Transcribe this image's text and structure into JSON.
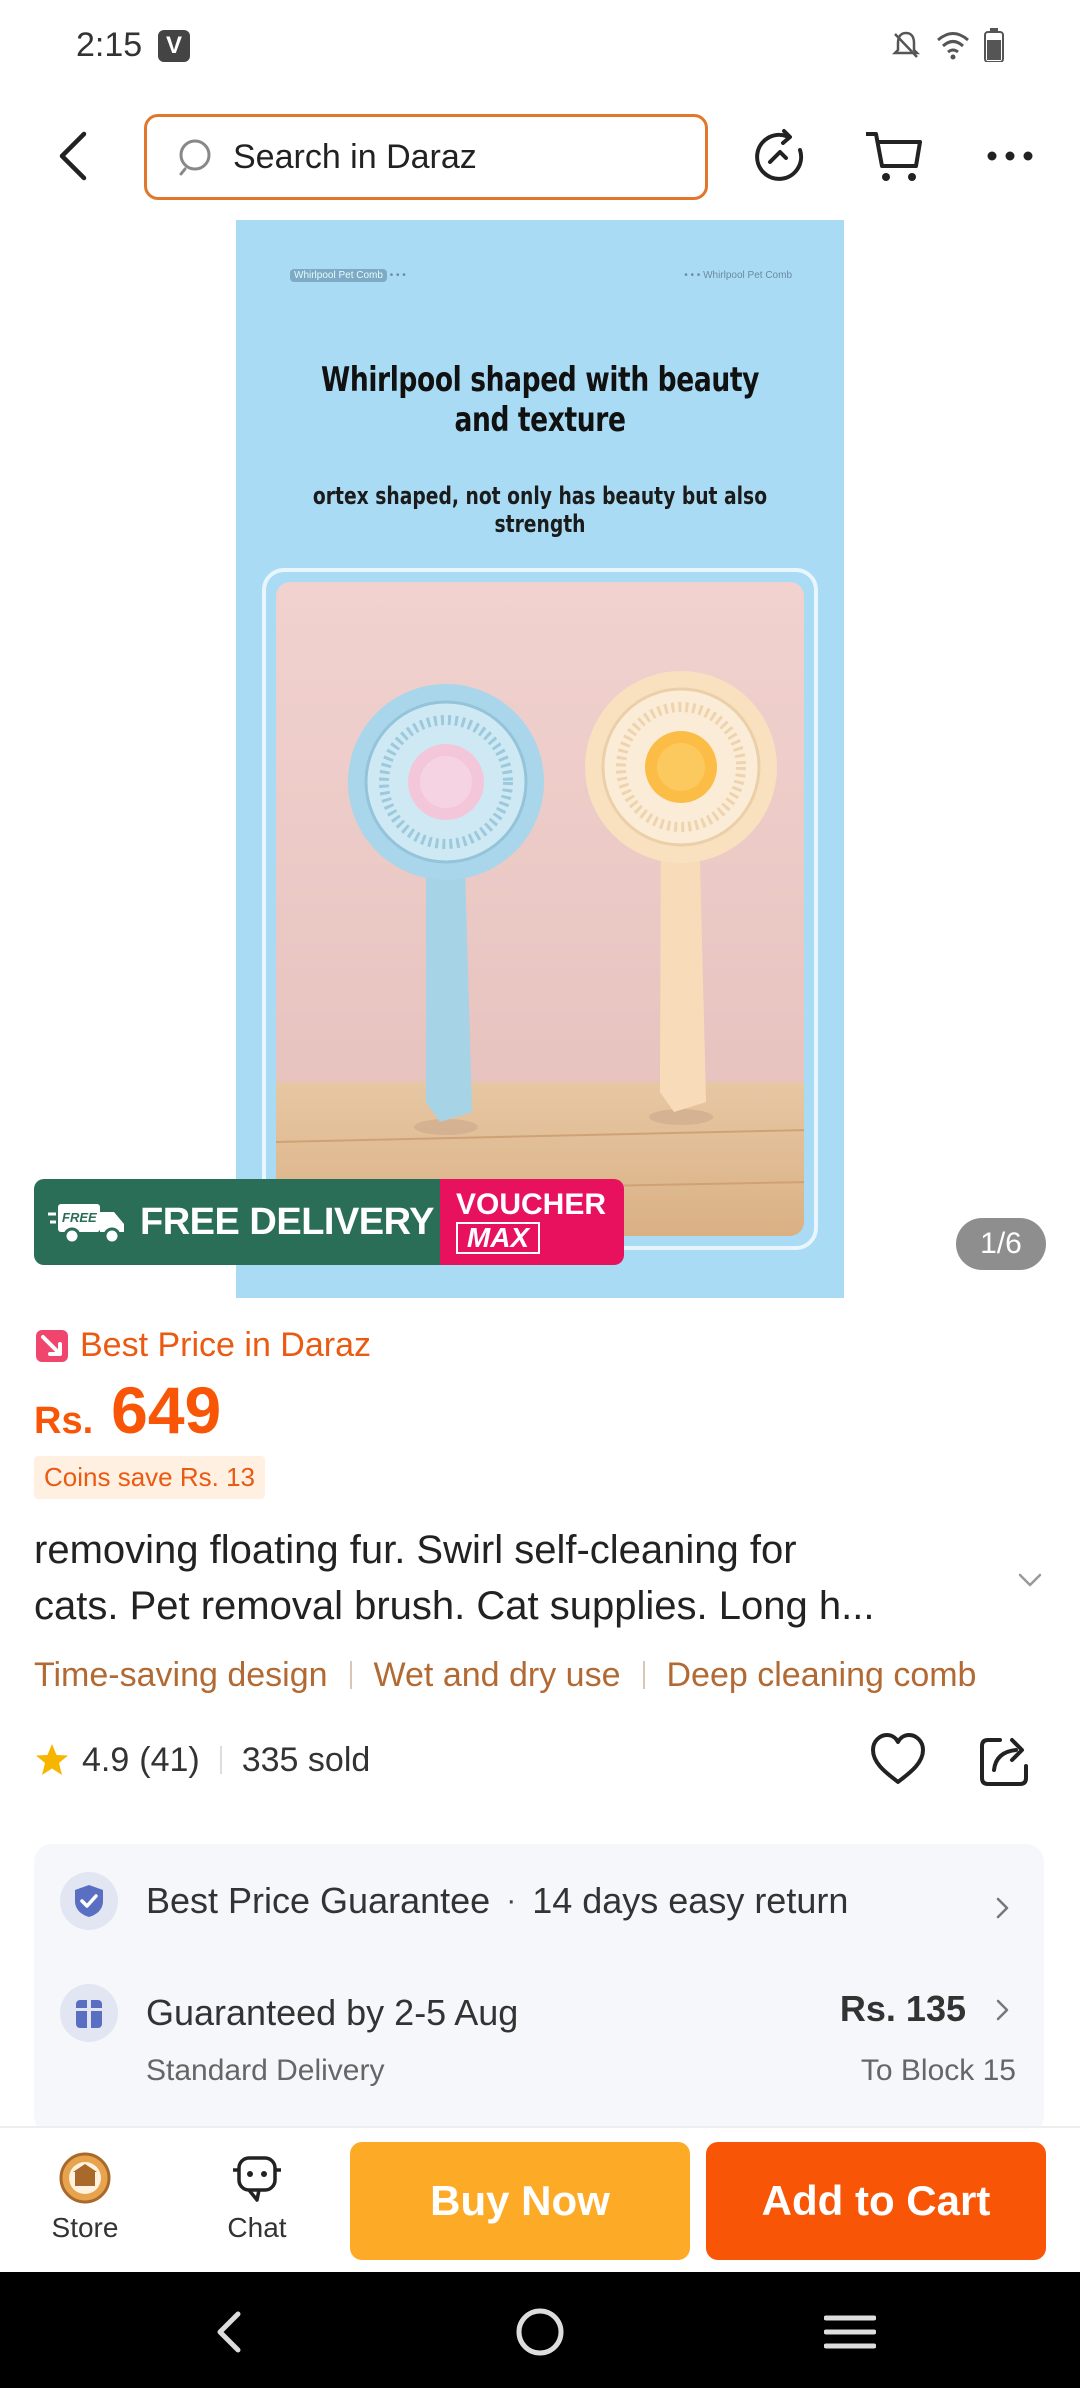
{
  "status_bar": {
    "time": "2:15",
    "app_badge": "V"
  },
  "search": {
    "placeholder": "Search in Daraz"
  },
  "gallery": {
    "small_label_left": "Whirlpool Pet Comb",
    "small_label_right": "Whirlpool Pet Comb",
    "headline": "Whirlpool shaped with beauty and texture",
    "subheadline": "ortex shaped, not only has beauty but also strength",
    "counter": "1/6"
  },
  "badge": {
    "free_tag": "FREE",
    "delivery": "FREE DELIVERY",
    "voucher": "VOUCHER",
    "max": "MAX"
  },
  "price_block": {
    "best_price": "Best Price in Daraz",
    "currency": "Rs.",
    "amount": "649",
    "coins": "Coins save Rs. 13"
  },
  "product": {
    "title_line1": "removing floating fur. Swirl self-cleaning for",
    "title_line2": "cats. Pet removal brush. Cat supplies. Long h..."
  },
  "tags": [
    "Time-saving design",
    "Wet and dry use",
    "Deep cleaning comb"
  ],
  "rating": {
    "score": "4.9",
    "count": "(41)",
    "sold": "335 sold"
  },
  "services": {
    "guarantee": "Best Price Guarantee",
    "returns": "14 days easy return",
    "delivery_date": "Guaranteed by 2-5 Aug",
    "delivery_type": "Standard Delivery",
    "delivery_fee": "Rs. 135",
    "destination": "To Block 15"
  },
  "actions": {
    "store": "Store",
    "chat": "Chat",
    "buy_now": "Buy Now",
    "add_to_cart": "Add to Cart"
  },
  "colors": {
    "accent": "#f85606",
    "buy_now": "#fdab27",
    "search_border": "#e2762b",
    "free_delivery": "#2a6e57",
    "voucher": "#e8115e",
    "tag_text": "#b26a34"
  },
  "icons": [
    "back-icon",
    "search-icon",
    "history-icon",
    "cart-icon",
    "more-icon",
    "best-price-icon",
    "star-icon",
    "heart-icon",
    "share-icon",
    "shield-icon",
    "gift-icon",
    "store-icon",
    "chat-icon"
  ]
}
